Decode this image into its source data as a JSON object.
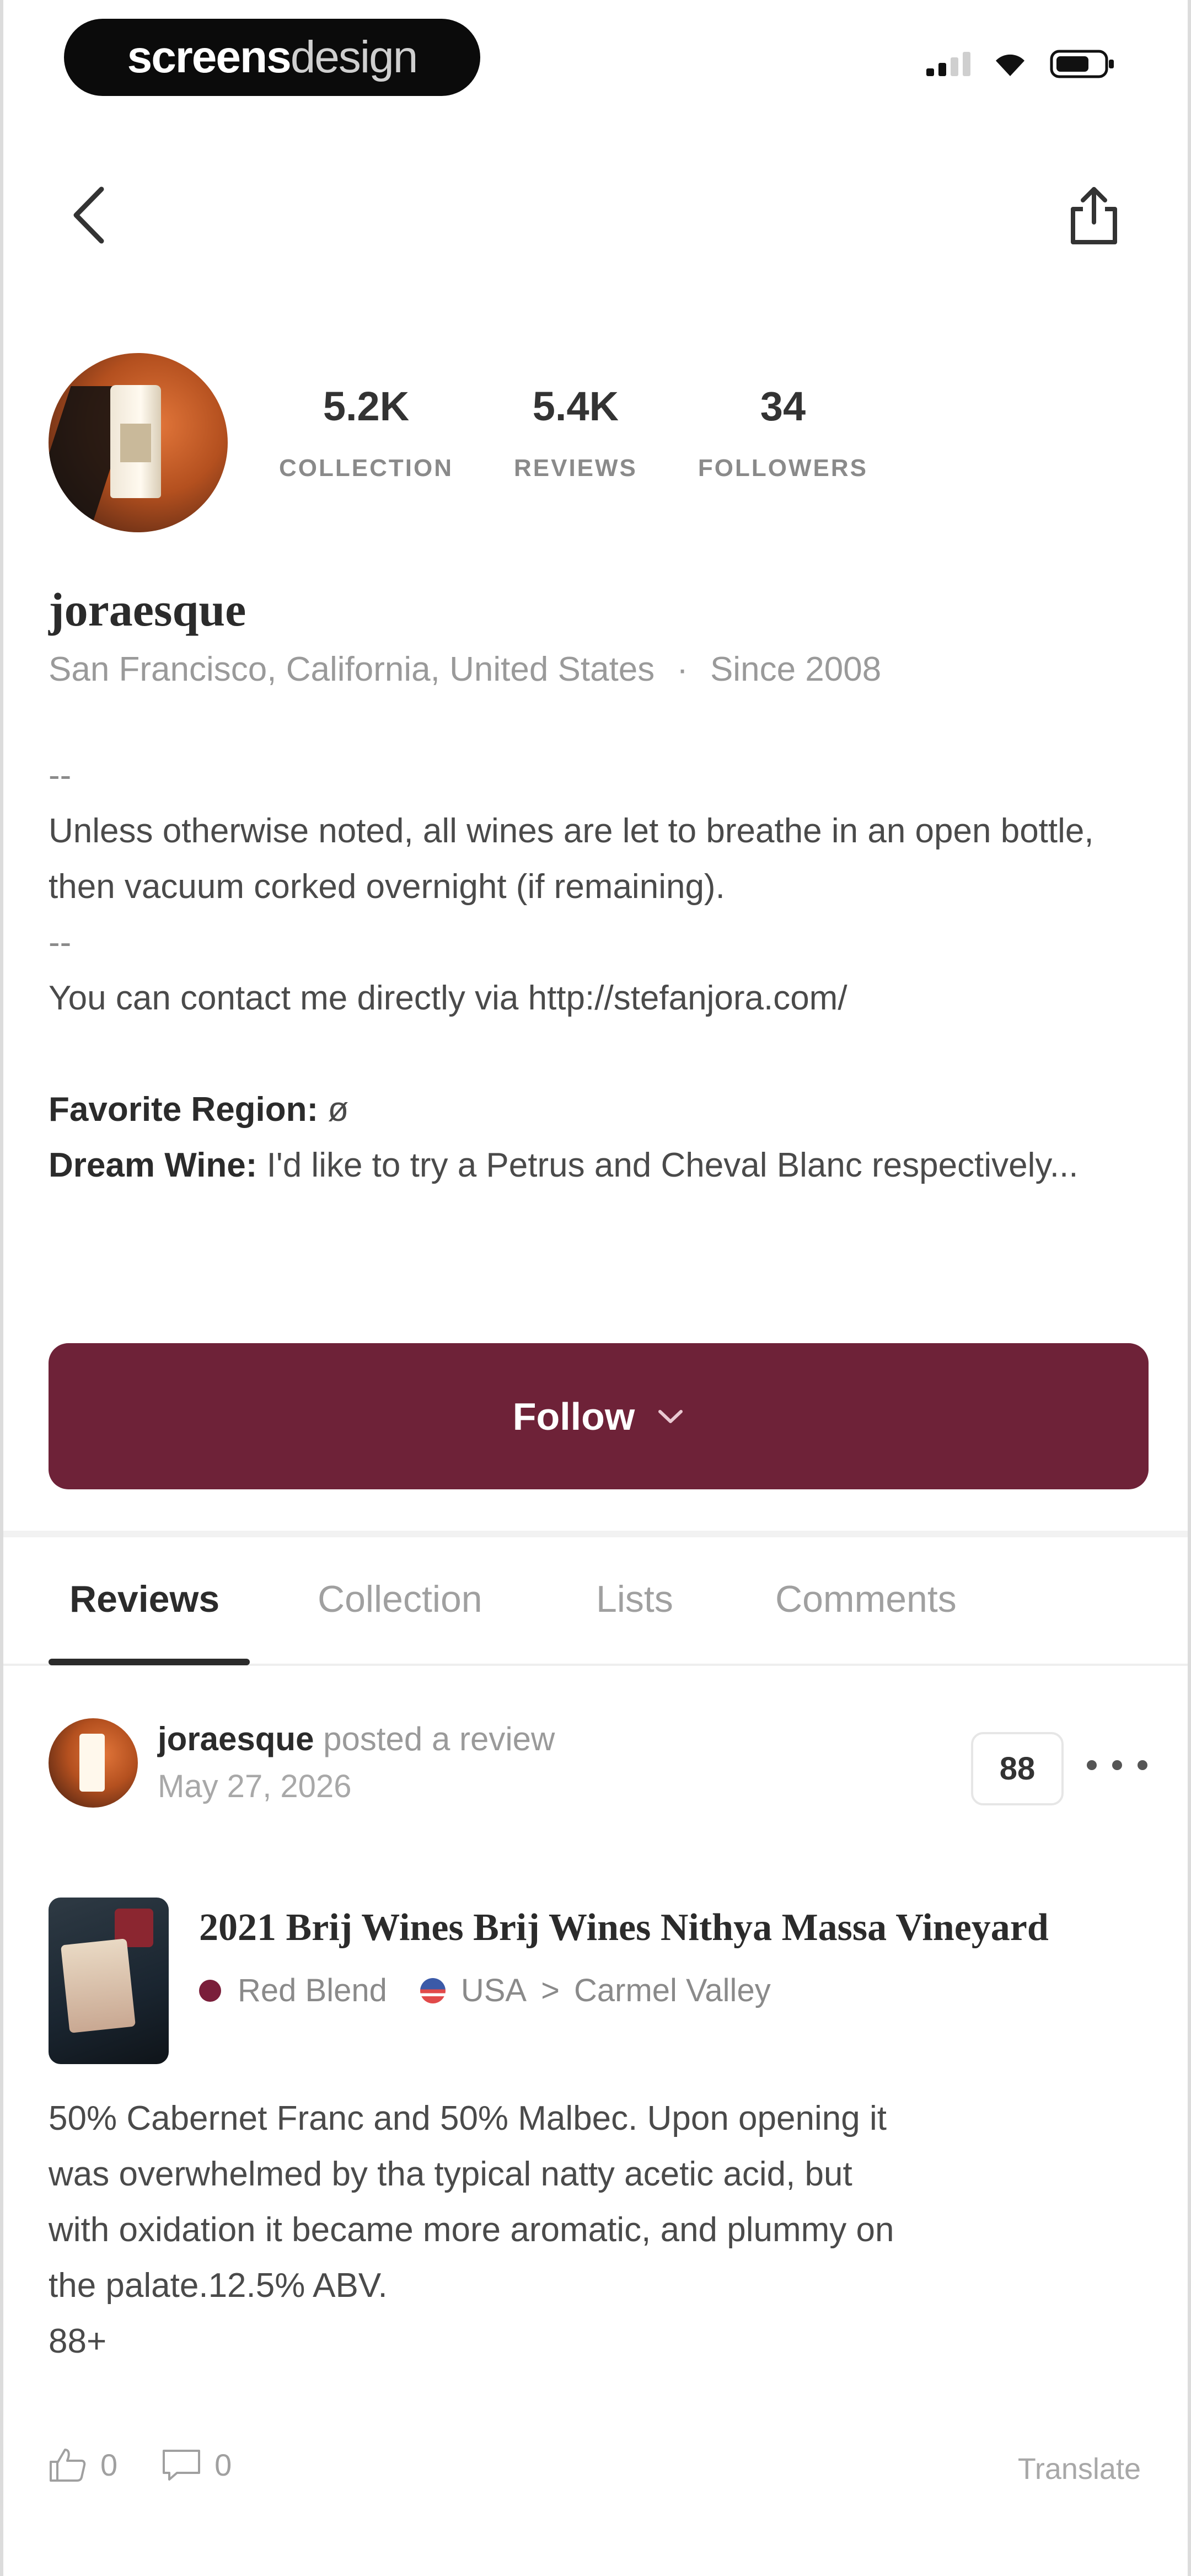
{
  "status_bar": {
    "brand_part1": "screens",
    "brand_part2": "design"
  },
  "profile": {
    "stats": [
      {
        "value": "5.2K",
        "label": "COLLECTION"
      },
      {
        "value": "5.4K",
        "label": "REVIEWS"
      },
      {
        "value": "34",
        "label": "FOLLOWERS"
      }
    ],
    "username": "joraesque",
    "location": "San Francisco, California, United States",
    "separator": "·",
    "since": "Since 2008",
    "bio": {
      "dash1": "--",
      "line1": "Unless otherwise noted, all wines are let to breathe in an open bottle, then vacuum corked overnight (if remaining).",
      "dash2": "--",
      "line2": "You can contact me directly via http://stefanjora.com/",
      "fav_region_label": "Favorite Region:",
      "fav_region_value": "ø",
      "dream_wine_label": "Dream Wine:",
      "dream_wine_value": "I'd like to try a Petrus and Cheval Blanc respectively..."
    }
  },
  "follow_button": {
    "label": "Follow"
  },
  "tabs": [
    "Reviews",
    "Collection",
    "Lists",
    "Comments"
  ],
  "post": {
    "author": "joraesque",
    "action": "posted a review",
    "date": "May 27, 2026",
    "score": "88",
    "wine": {
      "name": "2021 Brij Wines Brij Wines Nithya Massa Vineyard",
      "type": "Red Blend",
      "country": "USA",
      "arrow": ">",
      "region": "Carmel Valley"
    },
    "review_lines": [
      "50% Cabernet Franc and 50% Malbec. Upon opening it",
      "was overwhelmed by tha typical natty acetic acid, but",
      "with oxidation it became more aromatic, and plummy on",
      "the palate.12.5% ABV.",
      "88+"
    ],
    "likes": "0",
    "comments": "0",
    "translate": "Translate"
  }
}
